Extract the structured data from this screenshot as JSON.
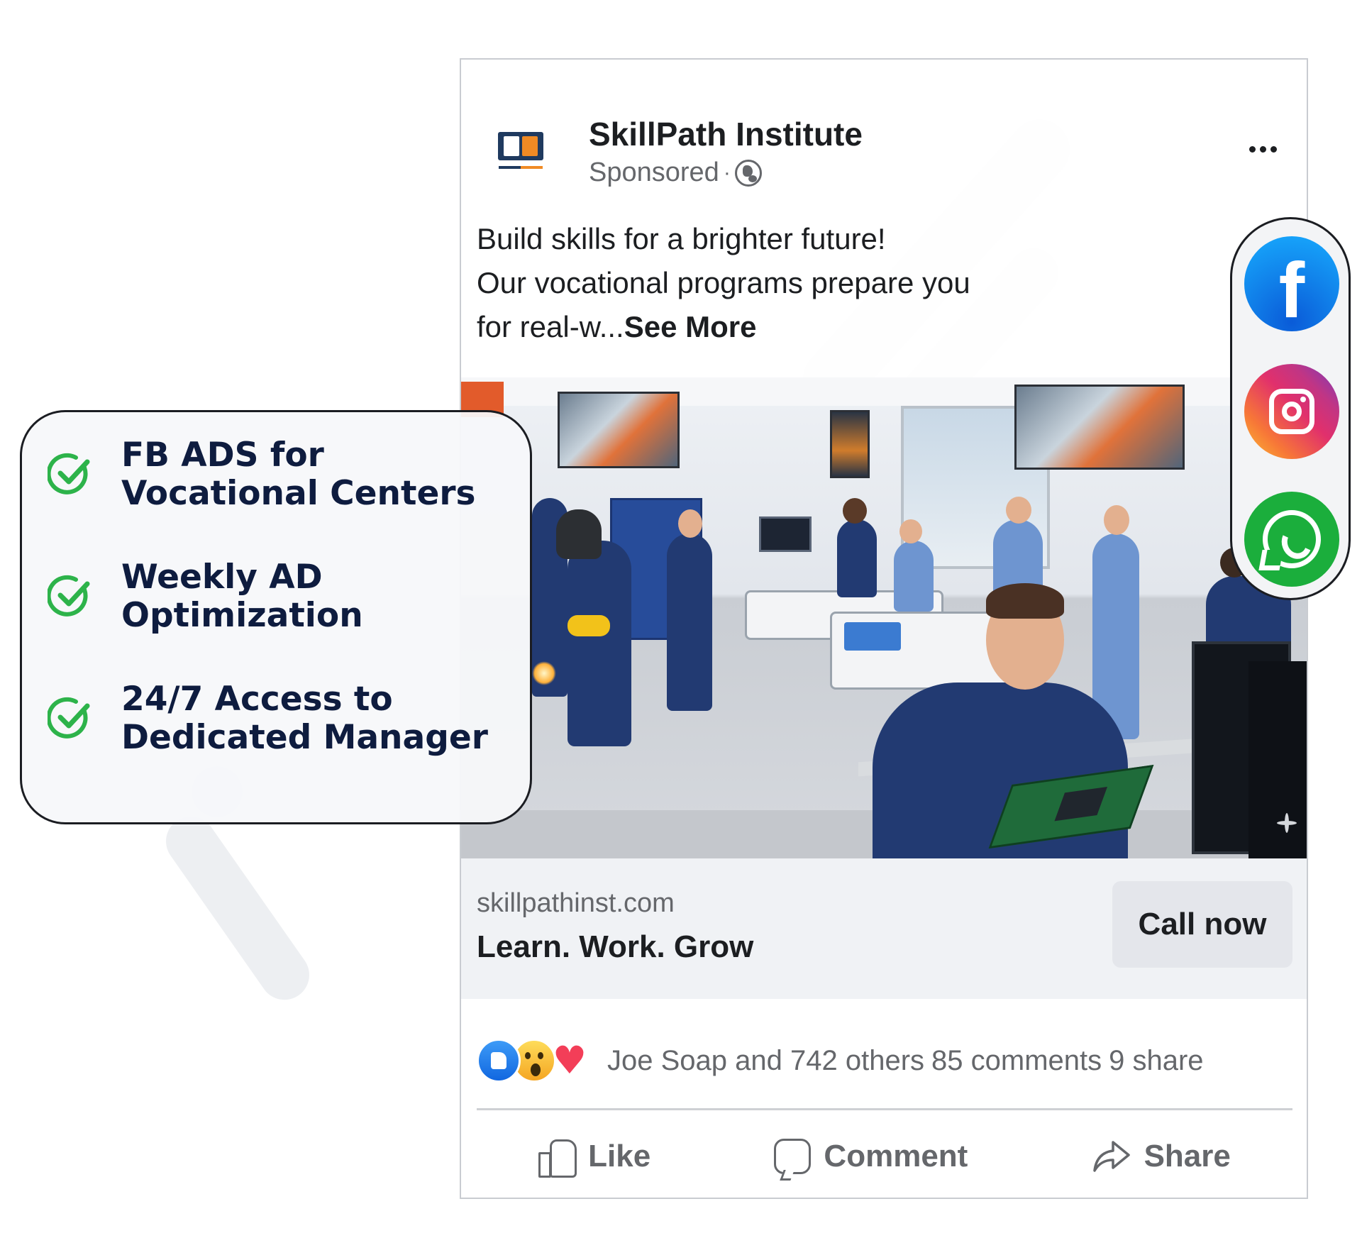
{
  "post": {
    "page_name": "SkillPath Institute",
    "sponsored": "Sponsored",
    "separator": "·",
    "text_line1": "Build skills for a brighter future!",
    "text_line2": "Our vocational programs prepare you",
    "text_line3_prefix": "for real-w...",
    "see_more": "See More",
    "link_domain": "skillpathinst.com",
    "link_headline": "Learn. Work. Grow",
    "cta_label": "Call now",
    "reactions_text": "Joe Soap and 742 others",
    "comments_text": "85 comments",
    "shares_text": "9 share",
    "action_like": "Like",
    "action_comment": "Comment",
    "action_share": "Share"
  },
  "features": {
    "items": [
      {
        "line1": "FB ADS for",
        "line2": "Vocational Centers"
      },
      {
        "line1": "Weekly AD",
        "line2": "Optimization"
      },
      {
        "line1": "24/7 Access to",
        "line2": "Dedicated Manager"
      }
    ]
  },
  "social": {
    "icons": [
      "facebook-icon",
      "instagram-icon",
      "whatsapp-icon"
    ]
  },
  "colors": {
    "facebook_blue": "#1877f2",
    "check_green": "#2db34a",
    "feature_text": "#0e1c3f",
    "whatsapp_green": "#1bae3c"
  }
}
